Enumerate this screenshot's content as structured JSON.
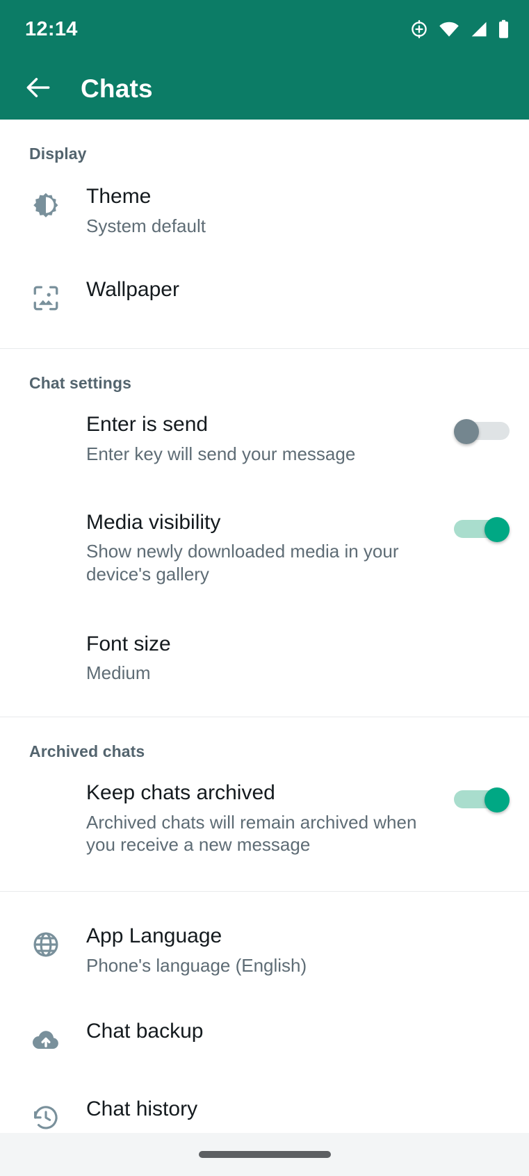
{
  "status_bar": {
    "time": "12:14",
    "icons": [
      "location-icon",
      "wifi-icon",
      "cellular-signal-icon",
      "battery-icon"
    ]
  },
  "app_bar": {
    "back_icon": "back-arrow-icon",
    "title": "Chats"
  },
  "colors": {
    "header_green": "#0C7C66",
    "toggle_on": "#00A884",
    "toggle_on_track": "#A9DDCD",
    "toggle_off_knob": "#74868F",
    "toggle_off_track": "#DFE3E5",
    "title_text": "#141A1E",
    "subtitle_text": "#5E6C75",
    "section_header_text": "#53646E",
    "icon_gray": "#79909B"
  },
  "sections": [
    {
      "header": "Display",
      "rows": [
        {
          "icon": "brightness-theme-icon",
          "title": "Theme",
          "subtitle": "System default",
          "toggle": null
        },
        {
          "icon": "wallpaper-image-icon",
          "title": "Wallpaper",
          "subtitle": "",
          "toggle": null
        }
      ]
    },
    {
      "header": "Chat settings",
      "rows": [
        {
          "icon": "",
          "title": "Enter is send",
          "subtitle": "Enter key will send your message",
          "toggle": "off"
        },
        {
          "icon": "",
          "title": "Media visibility",
          "subtitle": "Show newly downloaded media in your device's gallery",
          "toggle": "on"
        },
        {
          "icon": "",
          "title": "Font size",
          "subtitle": "Medium",
          "toggle": null
        }
      ]
    },
    {
      "header": "Archived chats",
      "rows": [
        {
          "icon": "",
          "title": "Keep chats archived",
          "subtitle": "Archived chats will remain archived when you receive a new message",
          "toggle": "on"
        }
      ]
    },
    {
      "header": "",
      "rows": [
        {
          "icon": "globe-icon",
          "title": "App Language",
          "subtitle": "Phone's language (English)",
          "toggle": null
        },
        {
          "icon": "cloud-upload-icon",
          "title": "Chat backup",
          "subtitle": "",
          "toggle": null
        },
        {
          "icon": "history-clock-icon",
          "title": "Chat history",
          "subtitle": "",
          "toggle": null
        }
      ]
    }
  ],
  "nav_bar": {
    "gesture_pill": "home-gesture-pill"
  }
}
